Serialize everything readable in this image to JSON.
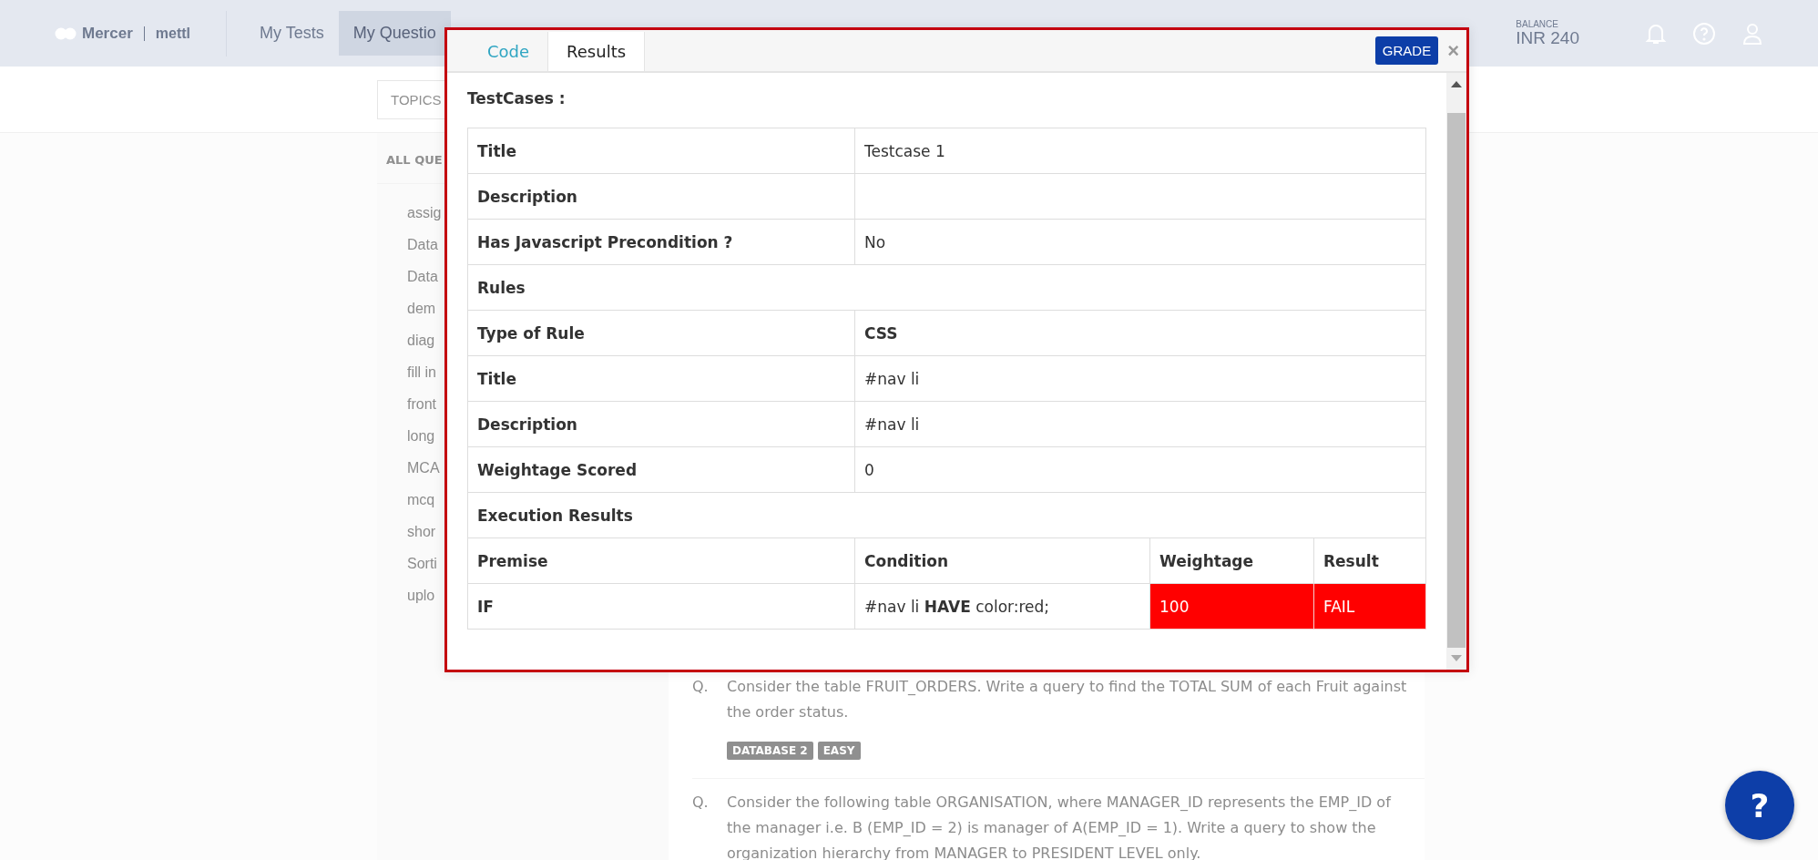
{
  "nav": {
    "logo": {
      "brand": "Mercer",
      "product": "mettl"
    },
    "items": [
      {
        "label": "My Tests",
        "selected": false
      },
      {
        "label": "My Questio",
        "selected": true
      }
    ],
    "balance": {
      "label": "BALANCE",
      "value": "INR 240"
    }
  },
  "topics_tab": "TOPICS",
  "sidebar": {
    "heading": "ALL QUE",
    "items": [
      "assig",
      "Data",
      "Data",
      "dem",
      "diag",
      "fill in",
      "front",
      "long",
      "MCA",
      "mcq",
      "shor",
      "Sorti",
      "uplo"
    ]
  },
  "questions": [
    {
      "marker": "Q.",
      "text": "Consider the table FRUIT_ORDERS. Write a query to find the TOTAL SUM of each Fruit against the order status.",
      "tags": [
        "DATABASE 2",
        "EASY"
      ]
    },
    {
      "marker": "Q.",
      "text": "Consider the following table ORGANISATION, where MANAGER_ID represents the EMP_ID of the manager i.e. B (EMP_ID = 2) is manager of A(EMP_ID = 1). Write a query to show the organization hierarchy from MANAGER to PRESIDENT LEVEL only."
    }
  ],
  "modal": {
    "tabs": [
      {
        "label": "Code",
        "selected": false
      },
      {
        "label": "Results",
        "selected": true
      }
    ],
    "grade_button": "GRADE",
    "close": "×",
    "heading": "TestCases :",
    "rows": [
      {
        "kind": "pair",
        "label": "Title",
        "value": "Testcase 1"
      },
      {
        "kind": "pair",
        "label": "Description"
      },
      {
        "kind": "pair",
        "label": "Has Javascript Precondition ?",
        "value": "No"
      },
      {
        "kind": "section",
        "label": "Rules"
      },
      {
        "kind": "pair",
        "label": "Type of Rule",
        "value": "CSS",
        "emphasis": true
      },
      {
        "kind": "pair",
        "label": "Title",
        "value": "#nav li"
      },
      {
        "kind": "pair",
        "label": "Description",
        "value": "#nav li"
      },
      {
        "kind": "pair",
        "label": "Weightage Scored",
        "value": "0"
      },
      {
        "kind": "section",
        "label": "Execution Results"
      },
      {
        "kind": "header",
        "cells": [
          "Premise",
          "Condition",
          "Weightage",
          "Result"
        ]
      },
      {
        "kind": "result",
        "premise": "IF",
        "condition": "#nav li **HAVE** color:red;",
        "weightage": "100",
        "result": "FAIL",
        "failed": true
      }
    ]
  },
  "help_button": "?"
}
